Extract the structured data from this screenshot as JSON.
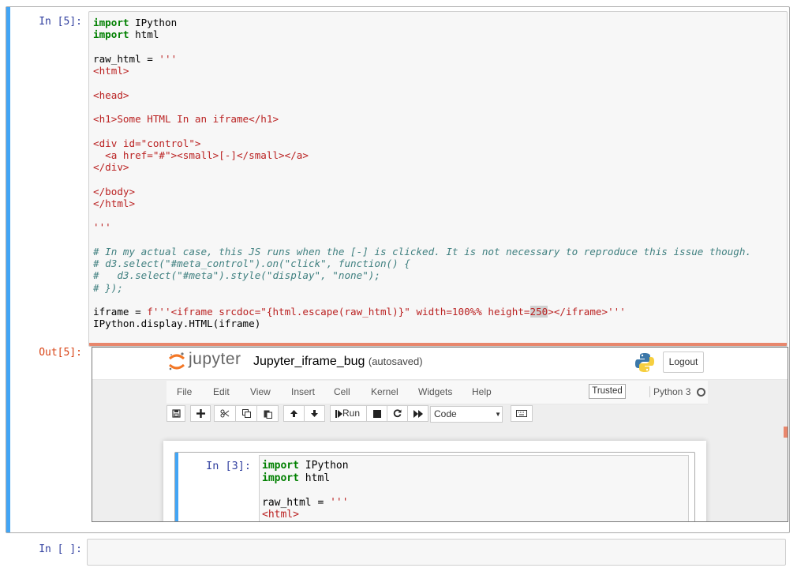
{
  "cell5": {
    "prompt_in": "In [5]:",
    "prompt_out": "Out[5]:",
    "code": {
      "l1_kw": "import",
      "l1_rest": " IPython",
      "l2_kw": "import",
      "l2_rest": " html",
      "l4_pre": "raw_html = ",
      "l4_str": "'''",
      "l5": "<html>",
      "l7": "<head>",
      "l9": "<h1>Some HTML In an iframe</h1>",
      "l11": "<div id=\"control\">",
      "l12": "  <a href=\"#\"><small>[-]</small></a>",
      "l13": "</div>",
      "l15": "</body>",
      "l16": "</html>",
      "l18": "'''",
      "l20": "# In my actual case, this JS runs when the [-] is clicked. It is not necessary to reproduce this issue though.",
      "l21": "# d3.select(\"#meta_control\").on(\"click\", function() {",
      "l22": "#   d3.select(\"#meta\").style(\"display\", \"none\");",
      "l23": "# });",
      "l25_pre": "iframe = ",
      "l25_str1": "f'''<iframe srcdoc=\"{html.escape(raw_html)}\" width=100%% height=",
      "l25_hl": "250",
      "l25_str2": "></iframe>'''",
      "l26": "IPython.display.HTML(iframe)"
    }
  },
  "iframe": {
    "jupyter_word": "jupyter",
    "notebook_title": "Jupyter_iframe_bug",
    "autosave_status": "(autosaved)",
    "logout_label": "Logout",
    "menu": [
      "File",
      "Edit",
      "View",
      "Insert",
      "Cell",
      "Kernel",
      "Widgets",
      "Help"
    ],
    "trusted_label": "Trusted",
    "kernel_name": "Python 3",
    "toolbar": {
      "run_label": "Run",
      "cell_type": "Code",
      "icons": [
        "save-icon",
        "plus-icon",
        "cut-icon",
        "copy-icon",
        "paste-icon",
        "arrow-up-icon",
        "arrow-down-icon",
        "step-forward-icon",
        "stop-icon",
        "refresh-icon",
        "fast-forward-icon",
        "keyboard-icon"
      ]
    },
    "inner_cell": {
      "prompt": "In [3]:",
      "l1_kw": "import",
      "l1_rest": " IPython",
      "l2_kw": "import",
      "l2_rest": " html",
      "l4_pre": "raw_html = ",
      "l4_str": "'''",
      "l5": "<html>"
    },
    "colors": {
      "accent_blue": "#42a5f5",
      "orange": "#e8876d"
    }
  },
  "empty_cell": {
    "prompt": "In [ ]:"
  }
}
